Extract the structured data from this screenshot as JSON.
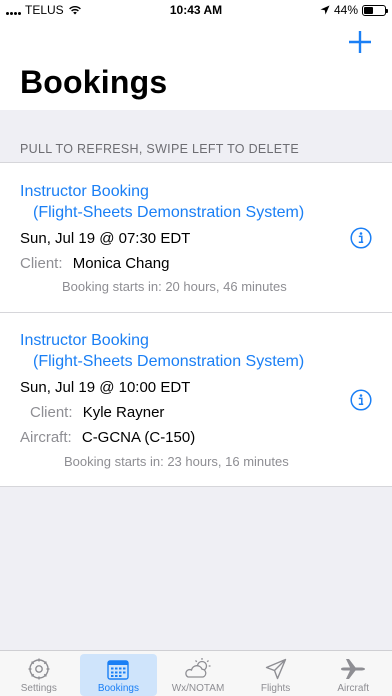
{
  "status_bar": {
    "carrier": "TELUS",
    "time": "10:43 AM",
    "battery": "44%",
    "battery_level": 0.44
  },
  "nav": {
    "title": "Bookings",
    "add_icon": "plus-icon"
  },
  "hint": "PULL TO REFRESH, SWIPE LEFT TO DELETE",
  "bookings": [
    {
      "title": "Instructor Booking",
      "subtitle": "(Flight-Sheets Demonstration System)",
      "date": "Sun, Jul 19 @ 07:30 EDT",
      "client_label": "Client:",
      "client": "Monica Chang",
      "note": "Booking starts in: 20 hours, 46 minutes"
    },
    {
      "title": "Instructor Booking",
      "subtitle": "(Flight-Sheets Demonstration System)",
      "date": "Sun, Jul 19 @ 10:00 EDT",
      "client_label": "Client:",
      "client": "Kyle Rayner",
      "aircraft_label": "Aircraft:",
      "aircraft": "C-GCNA (C-150)",
      "note": "Booking starts in: 23 hours, 16 minutes"
    }
  ],
  "tabbar": {
    "active": "Bookings",
    "items": [
      {
        "label": "Settings",
        "icon": "gear-icon"
      },
      {
        "label": "Bookings",
        "icon": "calendar-icon"
      },
      {
        "label": "Wx/NOTAM",
        "icon": "weather-icon"
      },
      {
        "label": "Flights",
        "icon": "paper-plane-icon"
      },
      {
        "label": "Aircraft",
        "icon": "airplane-icon"
      }
    ]
  },
  "colors": {
    "accent": "#1a7ff5",
    "secondary_text": "#8e8e93",
    "background": "#efeff4"
  }
}
